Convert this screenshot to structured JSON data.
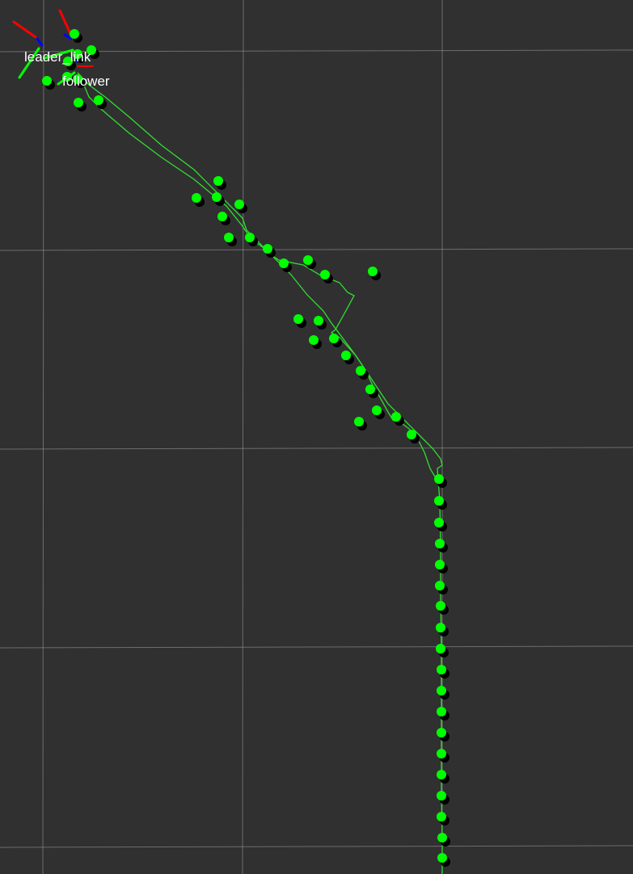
{
  "scene": {
    "background_color": "#303030",
    "grid_color": "#a0a0a0",
    "path_color": "#33dd33",
    "marker_color": "#00ff00",
    "marker_shadow_color": "#000000",
    "axis_colors": {
      "x": "#ff0000",
      "y": "#00ff00",
      "z": "#0000ff"
    }
  },
  "frames": {
    "leader": {
      "label": "leader_link"
    },
    "follower": {
      "label": "follower"
    }
  }
}
